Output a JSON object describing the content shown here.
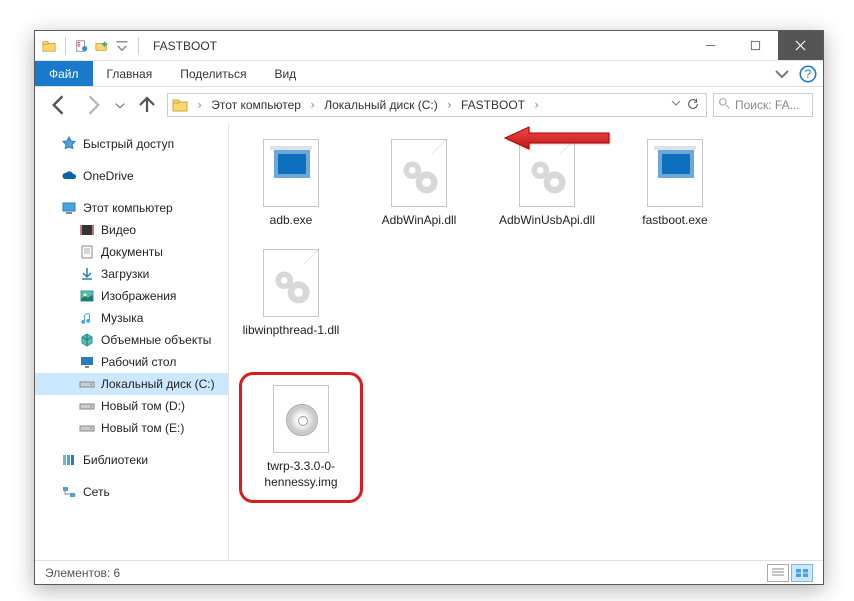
{
  "window": {
    "title": "FASTBOOT"
  },
  "ribbon": {
    "file": "Файл",
    "home": "Главная",
    "share": "Поделиться",
    "view": "Вид"
  },
  "breadcrumb": {
    "this_pc": "Этот компьютер",
    "drive": "Локальный диск (C:)",
    "folder": "FASTBOOT"
  },
  "search": {
    "placeholder": "Поиск: FA..."
  },
  "nav": {
    "quick_access": "Быстрый доступ",
    "onedrive": "OneDrive",
    "this_pc": "Этот компьютер",
    "videos": "Видео",
    "documents": "Документы",
    "downloads": "Загрузки",
    "pictures": "Изображения",
    "music": "Музыка",
    "objects3d": "Объемные объекты",
    "desktop": "Рабочий стол",
    "local_c": "Локальный диск (C:)",
    "vol_d": "Новый том (D:)",
    "vol_e": "Новый том (E:)",
    "libraries": "Библиотеки",
    "network": "Сеть"
  },
  "files": {
    "adb": "adb.exe",
    "adbwinapi": "AdbWinApi.dll",
    "adbwinusb": "AdbWinUsbApi.dll",
    "fastboot": "fastboot.exe",
    "libwin": "libwinpthread-1.dll",
    "twrp": "twrp-3.3.0-0-hennessy.img"
  },
  "status": {
    "elements": "Элементов: 6"
  }
}
